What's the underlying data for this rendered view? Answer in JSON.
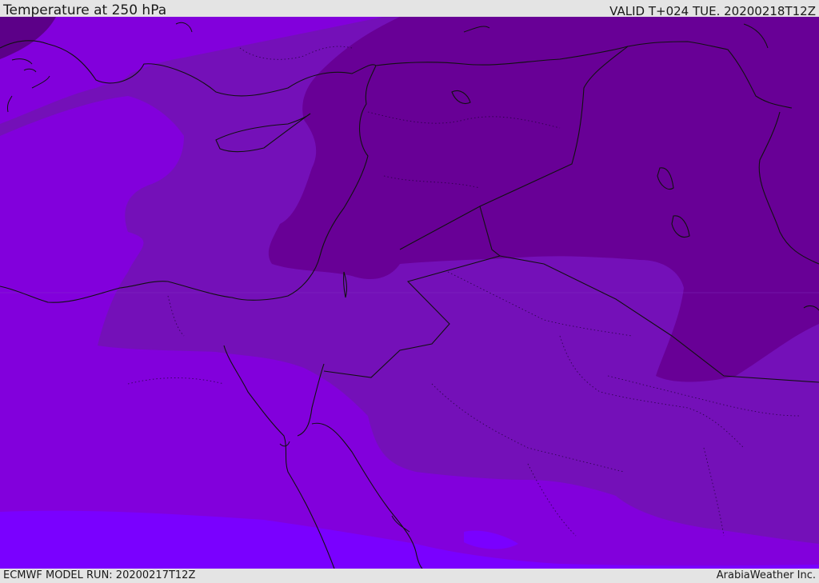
{
  "header": {
    "title": "Temperature at 250 hPa",
    "valid": "VALID T+024 TUE. 20200218T12Z"
  },
  "footer": {
    "model_run": "ECMWF MODEL RUN: 20200217T12Z",
    "credit": "ArabiaWeather Inc."
  },
  "colors": {
    "band_warmest": "#7a00ff",
    "band_warm": "#8200dc",
    "band_mid": "#7410b8",
    "band_cold": "#680096",
    "band_coldest": "#5c0088",
    "border": "#111111"
  }
}
